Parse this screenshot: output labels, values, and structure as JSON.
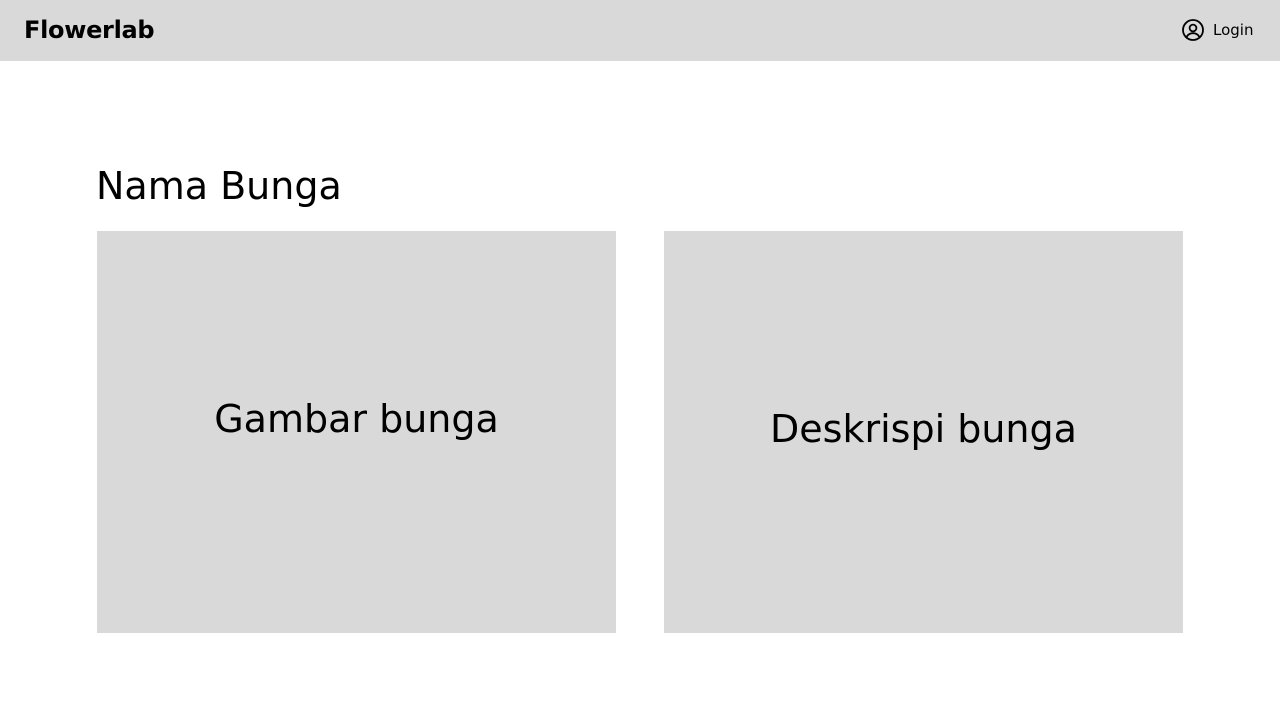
{
  "header": {
    "brand": "Flowerlab",
    "login_label": "Login",
    "login_icon": "user-circle-icon",
    "background": "#d9d9d9"
  },
  "main": {
    "title": "Nama Bunga",
    "image_placeholder": "Gambar bunga",
    "description_placeholder": "Deskrispi bunga",
    "panel_color": "#d9d9d9"
  }
}
